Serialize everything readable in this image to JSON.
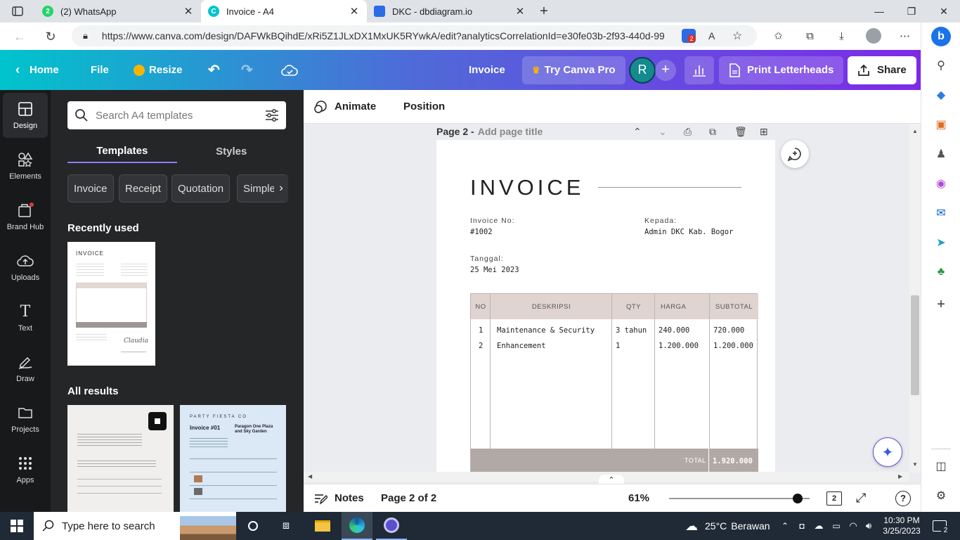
{
  "browser": {
    "tabs": [
      {
        "title": "(2) WhatsApp",
        "favicon_color": "#25d366",
        "badge": "2"
      },
      {
        "title": "Invoice - A4",
        "favicon_color": "#00c4cc"
      },
      {
        "title": "DKC - dbdiagram.io",
        "favicon_color": "#2b6be6"
      }
    ],
    "url": "https://www.canva.com/design/DAFWkBQihdE/xRi5Z1JLxDX1MxUK5RYwkA/edit?analyticsCorrelationId=e30fe03b-2f93-440d-99...",
    "extension_badge": "2"
  },
  "canva_top": {
    "home": "Home",
    "file": "File",
    "resize": "Resize",
    "doc_title": "Invoice",
    "try_pro": "Try Canva Pro",
    "avatar_letter": "R",
    "print": "Print Letterheads",
    "share": "Share"
  },
  "rail": [
    {
      "label": "Design",
      "icon": "design-icon"
    },
    {
      "label": "Elements",
      "icon": "elements-icon"
    },
    {
      "label": "Brand Hub",
      "icon": "brand-hub-icon"
    },
    {
      "label": "Uploads",
      "icon": "uploads-icon"
    },
    {
      "label": "Text",
      "icon": "text-icon"
    },
    {
      "label": "Draw",
      "icon": "draw-icon"
    },
    {
      "label": "Projects",
      "icon": "projects-icon"
    },
    {
      "label": "Apps",
      "icon": "apps-icon"
    }
  ],
  "panel": {
    "search_placeholder": "Search A4 templates",
    "tab_templates": "Templates",
    "tab_styles": "Styles",
    "chips": [
      "Invoice",
      "Receipt",
      "Quotation",
      "Simple i"
    ],
    "recently_used": "Recently used",
    "all_results": "All results",
    "thumb_invoice_title": "INVOICE",
    "thumb_party_brand": "PARTY FIESTA CO",
    "thumb_party_title": "Invoice #01",
    "thumb_party_venue": "Paragon One Plaza and Sky Garden"
  },
  "editor": {
    "animate": "Animate",
    "position": "Position",
    "page_label": "Page 2 -",
    "page_title_placeholder": "Add page title"
  },
  "invoice": {
    "heading": "INVOICE",
    "invoice_no_label": "Invoice No:",
    "invoice_no": "#1002",
    "to_label": "Kepada:",
    "to_value": "Admin DKC Kab. Bogor",
    "date_label": "Tanggal:",
    "date_value": "25 Mei 2023",
    "columns": {
      "no": "NO",
      "desc": "DESKRIPSI",
      "qty": "QTY",
      "price": "HARGA",
      "subtotal": "SUBTOTAL"
    },
    "rows": [
      {
        "no": "1",
        "desc": "Maintenance & Security",
        "qty": "3 tahun",
        "price": "240.000",
        "subtotal": "720.000"
      },
      {
        "no": "2",
        "desc": "Enhancement",
        "qty": "1",
        "price": "1.200.000",
        "subtotal": "1.200.000"
      }
    ],
    "total_label": "TOTAL",
    "total_value": "1.920.000"
  },
  "bottom": {
    "notes": "Notes",
    "page_indicator": "Page 2 of 2",
    "zoom": "61%",
    "zoom_fraction": 0.61,
    "page_count": "2"
  },
  "taskbar": {
    "search_placeholder": "Type here to search",
    "weather_temp": "25°C",
    "weather_text": "Berawan",
    "time": "10:30 PM",
    "date": "3/25/2023",
    "notif_count": "2"
  }
}
